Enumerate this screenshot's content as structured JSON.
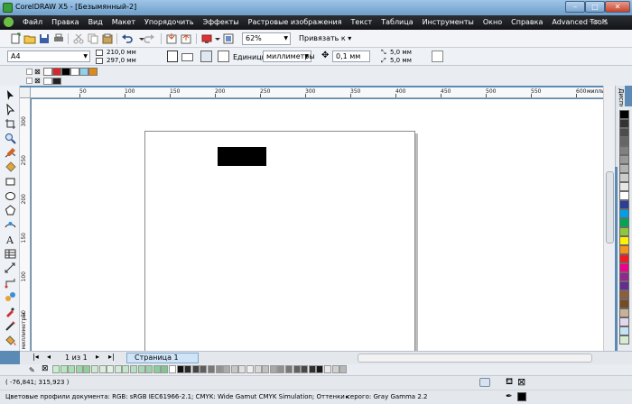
{
  "window": {
    "title": "CorelDRAW X5 - [Безымянный-2]",
    "min": "–",
    "max": "□",
    "close": "✕"
  },
  "menu": [
    "Файл",
    "Правка",
    "Вид",
    "Макет",
    "Упорядочить",
    "Эффекты",
    "Растровые изображения",
    "Текст",
    "Таблица",
    "Инструменты",
    "Окно",
    "Справка",
    "Advanced Tools"
  ],
  "menu_controls": "– ▫ ✕",
  "toolbar": {
    "zoom": "62%",
    "snap_label": "Привязать к"
  },
  "property_bar": {
    "paper": "A4",
    "width": "210,0 мм",
    "height": "297,0 мм",
    "units_label": "Единицы:",
    "units_value": "миллиметры",
    "nudge": "0,1 мм",
    "dup_x": "5,0 мм",
    "dup_y": "5,0 мм"
  },
  "rulers": {
    "h_ticks": [
      "50",
      "100",
      "150",
      "200",
      "250",
      "300",
      "350",
      "400",
      "450",
      "500",
      "550",
      "600"
    ],
    "h_units": "миллиметры",
    "v_ticks": [
      "300",
      "250",
      "200",
      "150",
      "100",
      "50"
    ],
    "v_units": "миллиметры"
  },
  "docker": {
    "tab_label": "Диспетчер объектов"
  },
  "pages": {
    "count": "1 из 1",
    "tab": "Страница 1"
  },
  "status": {
    "coords": "( -76,841; 315,923 )",
    "profiles": "Цветовые профили документа: RGB: sRGB IEC61966-2.1; CMYK: Wide Gamut CMYK Simulation; Оттенки серого: Gray Gamma 2.2"
  },
  "colors": {
    "doc_palette": [
      "#ffffff",
      "#d9252b",
      "#000000",
      "#ffffff",
      "#8fd0ea",
      "#dd8a1a"
    ],
    "palette": [
      "#000000",
      "#333333",
      "#4d4d4d",
      "#666666",
      "#808080",
      "#999999",
      "#b3b3b3",
      "#cccccc",
      "#e6e6e6",
      "#ffffff",
      "#2b3f99",
      "#00a0e9",
      "#00a651",
      "#8dc63f",
      "#fff200",
      "#f7941d",
      "#ed1c24",
      "#ec008c",
      "#92278f",
      "#662d91",
      "#8b5e3c",
      "#754c24",
      "#c7b299",
      "#e4d6ec",
      "#c5e3f6",
      "#d5ecd0"
    ],
    "recent": [
      "#c6efce",
      "#b7e7bf",
      "#a9dfb1",
      "#9bd7a3",
      "#8dcf95",
      "#cce9d3",
      "#d8eedd",
      "#e3f3e6",
      "#d1ecd7",
      "#c3e5cb",
      "#b6dfbf",
      "#a8d8b3",
      "#9ad2a7",
      "#8ccb9b",
      "#7ec58f",
      "#ffffff",
      "#111111",
      "#2a2a2a",
      "#444444",
      "#5e5e5e",
      "#787878",
      "#929292",
      "#acacac",
      "#c6c6c6",
      "#e0e0e0",
      "#f0f0f0",
      "#d8d8d8",
      "#c0c0c0",
      "#a8a8a8",
      "#909090",
      "#787878",
      "#606060",
      "#484848",
      "#303030",
      "#181818",
      "#e8e8e8",
      "#d0d0d0",
      "#b8b8b8"
    ]
  }
}
